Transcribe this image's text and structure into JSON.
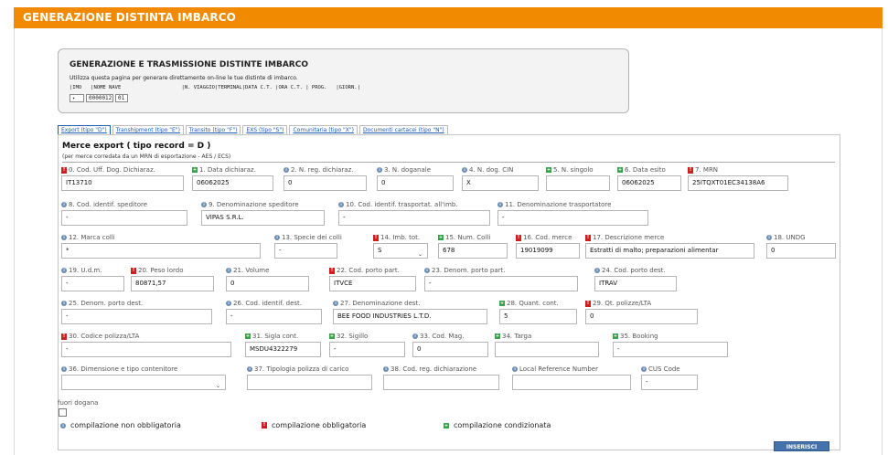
{
  "banner": {
    "title": "GENERAZIONE DISTINTA IMBARCO"
  },
  "top": {
    "title": "GENERAZIONE E TRASMISSIONE DISTINTE IMBARCO",
    "description": "Utilizza questa pagina per generare direttamente on-line le tue distinte di imbarco.",
    "header_line": "|IMO   |NOME NAVE                    |N. VIAGGIO|TERMINAL|DATA C.T. |ORA C.T. | PROG.   |GIORN.|",
    "imo_value": "",
    "nome_nave_code": "0000012",
    "nome_nave_suffix": "01"
  },
  "tabs": [
    "Export (tipo \"D\")",
    "Transhipment (tipo \"E\")",
    "Transito (tipo \"F\")",
    "EXS (tipo \"S\")",
    "Comunitaria (tipo \"X\")",
    "Documenti cartacei (tipo \"N\")"
  ],
  "section": {
    "title": "Merce export ( tipo record = D )",
    "subtitle": "(per merce corredata da un MRN di esportazione - AES / ECS)"
  },
  "fields": {
    "f0": {
      "label": "0. Cod. Uff. Dog. Dichiaraz.",
      "value": "IT13710"
    },
    "f1": {
      "label": "1. Data dichiaraz.",
      "value": "06062025"
    },
    "f2": {
      "label": "2. N. reg. dichiaraz.",
      "value": "0"
    },
    "f3": {
      "label": "3. N. doganale",
      "value": "0"
    },
    "f4": {
      "label": "4. N. dog. CIN",
      "value": "X"
    },
    "f5": {
      "label": "5. N. singolo",
      "value": ""
    },
    "f6": {
      "label": "6. Data esito",
      "value": "06062025"
    },
    "f7": {
      "label": "7. MRN",
      "value": "25ITQXT01EC34138A6"
    },
    "f8": {
      "label": "8. Cod. identif. speditore",
      "value": "-"
    },
    "f9": {
      "label": "9. Denominazione speditore",
      "value": "VIPAS S.R.L."
    },
    "f10": {
      "label": "10. Cod. identif. trasportat. all'imb.",
      "value": "-"
    },
    "f11": {
      "label": "11. Denominazione trasportatore",
      "value": "-"
    },
    "f12": {
      "label": "12. Marca colli",
      "value": "*"
    },
    "f13": {
      "label": "13. Specie dei colli",
      "value": "-"
    },
    "f14": {
      "label": "14. Imb. tot.",
      "value": "S"
    },
    "f15": {
      "label": "15. Num. Colli",
      "value": "678"
    },
    "f16": {
      "label": "16. Cod. merce",
      "value": "19019099"
    },
    "f17": {
      "label": "17. Descrizione merce",
      "value": "Estratti di malto; preparazioni alimentar"
    },
    "f18": {
      "label": "18. UNDG",
      "value": "0"
    },
    "f19": {
      "label": "19. U.d.m.",
      "value": "-"
    },
    "f20": {
      "label": "20. Peso lordo",
      "value": "80871,57"
    },
    "f21": {
      "label": "21. Volume",
      "value": "0"
    },
    "f22": {
      "label": "22. Cod. porto part.",
      "value": "ITVCE"
    },
    "f23": {
      "label": "23. Denom. porto part.",
      "value": "-"
    },
    "f24": {
      "label": "24. Cod. porto dest.",
      "value": "ITRAV"
    },
    "f25": {
      "label": "25. Denom. porto dest.",
      "value": "-"
    },
    "f26": {
      "label": "26. Cod. identif. dest.",
      "value": "-"
    },
    "f27": {
      "label": "27. Denominazione dest.",
      "value": "BEE FOOD INDUSTRIES L.T.D."
    },
    "f28": {
      "label": "28. Quant. cont.",
      "value": "5"
    },
    "f29": {
      "label": "29. Qt. polizze/LTA",
      "value": "0"
    },
    "f30": {
      "label": "30. Codice polizza/LTA",
      "value": "-"
    },
    "f31": {
      "label": "31. Sigla cont.",
      "value": "MSDU4322279"
    },
    "f32": {
      "label": "32. Sigillo",
      "value": "-"
    },
    "f33": {
      "label": "33. Cod. Mag.",
      "value": "0"
    },
    "f34": {
      "label": "34. Targa",
      "value": ""
    },
    "f35": {
      "label": "35. Booking",
      "value": "-"
    },
    "f36": {
      "label": "36. Dimensione e tipo contenitore",
      "value": ""
    },
    "f37": {
      "label": "37. Tipologia polizza di carico",
      "value": ""
    },
    "f38": {
      "label": "38. Cod. reg. dichiarazione",
      "value": ""
    },
    "f39": {
      "label": "Local Reference Number",
      "value": ""
    },
    "f40": {
      "label": "CUS Code",
      "value": "-"
    }
  },
  "fuori_dogana": {
    "label": "fuori dogana"
  },
  "legend": {
    "optional": "compilazione non obbligatoria",
    "required": "compilazione obbligatoria",
    "conditional": "compilazione condizionata"
  },
  "actions": {
    "insert_label": "INSERISCI"
  },
  "icons": {
    "optional": "info-circle-icon",
    "required": "exclamation-icon",
    "conditional": "plus-square-icon"
  },
  "colors": {
    "banner": "#f18a00",
    "optional": "#6d8db5",
    "required": "#cc1f1f",
    "conditional": "#3aa24a",
    "button": "#4472ad"
  }
}
